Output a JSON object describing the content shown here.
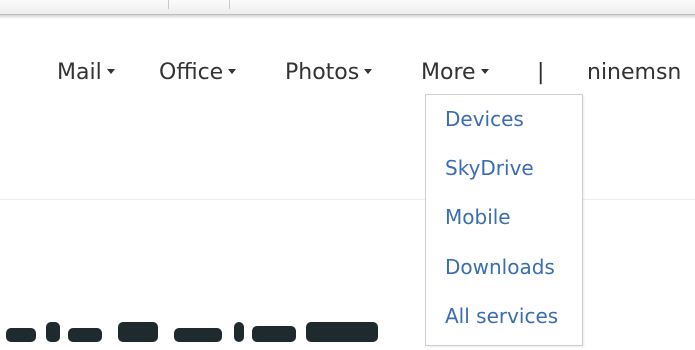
{
  "nav": {
    "items": [
      {
        "label": "Mail"
      },
      {
        "label": "Office"
      },
      {
        "label": "Photos"
      },
      {
        "label": "More"
      }
    ],
    "separator": "|",
    "brand": "ninemsn"
  },
  "more_menu": {
    "items": [
      {
        "label": "Devices"
      },
      {
        "label": "SkyDrive"
      },
      {
        "label": "Mobile"
      },
      {
        "label": "Downloads"
      },
      {
        "label": "All services"
      }
    ]
  },
  "colors": {
    "nav_text": "#333333",
    "menu_link": "#3b6db3",
    "menu_border": "#cfcfcf"
  },
  "icons": {
    "dropdown_caret": "chevron-down-icon"
  }
}
